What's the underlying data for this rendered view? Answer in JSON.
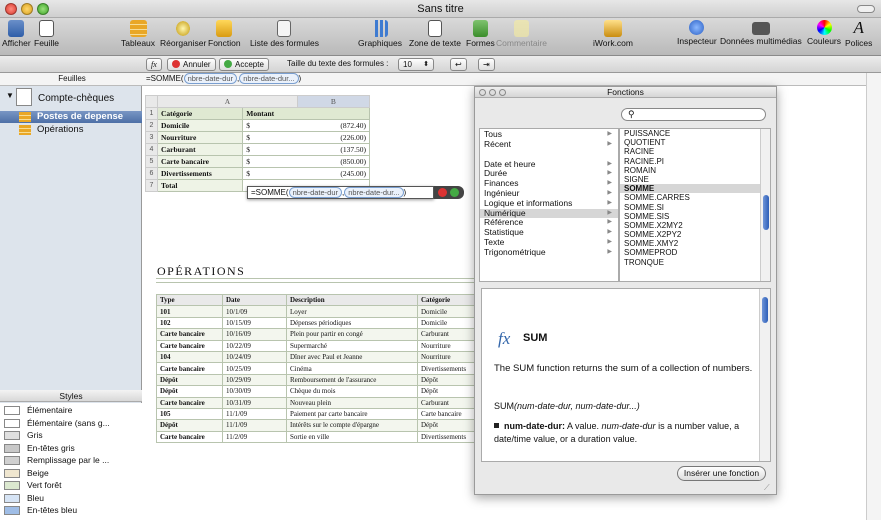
{
  "window": {
    "title": "Sans titre"
  },
  "toolbar": {
    "afficher": "Afficher",
    "feuille": "Feuille",
    "tableaux": "Tableaux",
    "reorganiser": "Réorganiser",
    "fonction": "Fonction",
    "liste_formules": "Liste des formules",
    "graphiques": "Graphiques",
    "zone_texte": "Zone de texte",
    "formes": "Formes",
    "commentaire": "Commentaire",
    "iwork": "iWork.com",
    "inspecteur": "Inspecteur",
    "multimedias": "Données multimédias",
    "couleurs": "Couleurs",
    "polices": "Polices"
  },
  "formatbar": {
    "fx": "fx",
    "annuler": "Annuler",
    "accepte": "Accepte",
    "taille_label": "Taille du texte des formules :",
    "taille_value": "10"
  },
  "formula": {
    "prefix": "=SOMME(",
    "arg1": "nbre-date-dur",
    "sep": ",",
    "arg2": "nbre-date-dur...",
    "suffix": ")"
  },
  "sidebar": {
    "header": "Feuilles",
    "sheet": "Compte-chèques",
    "items": [
      "Postes de depense",
      "Opérations"
    ],
    "styles_header": "Styles",
    "styles": [
      {
        "label": "Élémentaire",
        "color": "#ffffff"
      },
      {
        "label": "Élémentaire (sans g...",
        "color": "#ffffff"
      },
      {
        "label": "Gris",
        "color": "#e0e0e0"
      },
      {
        "label": "En-têtes gris",
        "color": "#c8c8c8"
      },
      {
        "label": "Remplissage par le ...",
        "color": "#d0d0d0"
      },
      {
        "label": "Beige",
        "color": "#efe6cf"
      },
      {
        "label": "Vert forêt",
        "color": "#dbe8cf"
      },
      {
        "label": "Bleu",
        "color": "#d6e4f5"
      },
      {
        "label": "En-têtes bleu",
        "color": "#9fbde6"
      }
    ]
  },
  "table1": {
    "col_a": "A",
    "col_b": "B",
    "headers": [
      "Catégorie",
      "Montant"
    ],
    "rows": [
      {
        "n": "1",
        "a": "Catégorie",
        "c": "",
        "b": "Montant"
      },
      {
        "n": "2",
        "a": "Domicile",
        "c": "$",
        "b": "(872.40)"
      },
      {
        "n": "3",
        "a": "Nourriture",
        "c": "$",
        "b": "(226.00)"
      },
      {
        "n": "4",
        "a": "Carburant",
        "c": "$",
        "b": "(137.50)"
      },
      {
        "n": "5",
        "a": "Carte bancaire",
        "c": "$",
        "b": "(850.00)"
      },
      {
        "n": "6",
        "a": "Divertissements",
        "c": "$",
        "b": "(245.00)"
      },
      {
        "n": "7",
        "a": "Total",
        "c": "",
        "b": ""
      }
    ],
    "editor": {
      "prefix": "=SOMME(",
      "arg1": "nbre-date-dur",
      "sep": ",",
      "arg2": "nbre-date-dur...",
      "suffix": ")"
    }
  },
  "table2": {
    "title": "OPÉRATIONS",
    "headers": [
      "Type",
      "Date",
      "Description",
      "Catégorie"
    ],
    "rows": [
      [
        "101",
        "10/1/09",
        "Loyer",
        "Domicile"
      ],
      [
        "102",
        "10/15/09",
        "Dépenses périodiques",
        "Domicile"
      ],
      [
        "Carte bancaire",
        "10/16/09",
        "Plein pour partir en congé",
        "Carburant"
      ],
      [
        "Carte bancaire",
        "10/22/09",
        "Supermarché",
        "Nourriture"
      ],
      [
        "104",
        "10/24/09",
        "Dîner avec Paul et Jeanne",
        "Nourriture"
      ],
      [
        "Carte bancaire",
        "10/25/09",
        "Cinéma",
        "Divertissements"
      ],
      [
        "Dépôt",
        "10/29/09",
        "Remboursement de l'assurance",
        "Dépôt"
      ],
      [
        "Dépôt",
        "10/30/09",
        "Chèque du mois",
        "Dépôt"
      ],
      [
        "Carte bancaire",
        "10/31/09",
        "Nouveau plein",
        "Carburant"
      ],
      [
        "105",
        "11/1/09",
        "Paiement par carte bancaire",
        "Carte bancaire"
      ],
      [
        "Dépôt",
        "11/1/09",
        "Intérêts sur le compte d'épargne",
        "Dépôt"
      ],
      [
        "Carte bancaire",
        "11/2/09",
        "Sortie en ville",
        "Divertissements"
      ]
    ]
  },
  "panel": {
    "title": "Fonctions",
    "search_placeholder": "",
    "categories": [
      {
        "label": "Tous",
        "gap": false
      },
      {
        "label": "Récent",
        "gap": false
      },
      {
        "label": "Date et heure",
        "gap": true
      },
      {
        "label": "Durée",
        "gap": false
      },
      {
        "label": "Finances",
        "gap": false
      },
      {
        "label": "Ingénieur",
        "gap": false
      },
      {
        "label": "Logique et informations",
        "gap": false
      },
      {
        "label": "Numérique",
        "gap": false,
        "selected": true
      },
      {
        "label": "Référence",
        "gap": false
      },
      {
        "label": "Statistique",
        "gap": false
      },
      {
        "label": "Texte",
        "gap": false
      },
      {
        "label": "Trigonométrique",
        "gap": false
      }
    ],
    "functions": [
      "PUISSANCE",
      "QUOTIENT",
      "RACINE",
      "RACINE.PI",
      "ROMAIN",
      "SIGNE",
      "SOMME",
      "SOMME.CARRES",
      "SOMME.SI",
      "SOMME.SIS",
      "SOMME.X2MY2",
      "SOMME.X2PY2",
      "SOMME.XMY2",
      "SOMMEPROD",
      "TRONQUE"
    ],
    "selected_function": "SOMME",
    "fx_label": "fx",
    "fn_name": "SUM",
    "desc": "The SUM function returns the sum of a collection of numbers.",
    "syntax_name": "SUM",
    "syntax_args": "(num-date-dur, num-date-dur...)",
    "arg_name": "num-date-dur:",
    "arg_desc_1": " A value. ",
    "arg_desc_italic": "num-date-dur",
    "arg_desc_2": " is a number value, a date/time value, or a duration value.",
    "insert_button": "Insérer une fonction"
  }
}
